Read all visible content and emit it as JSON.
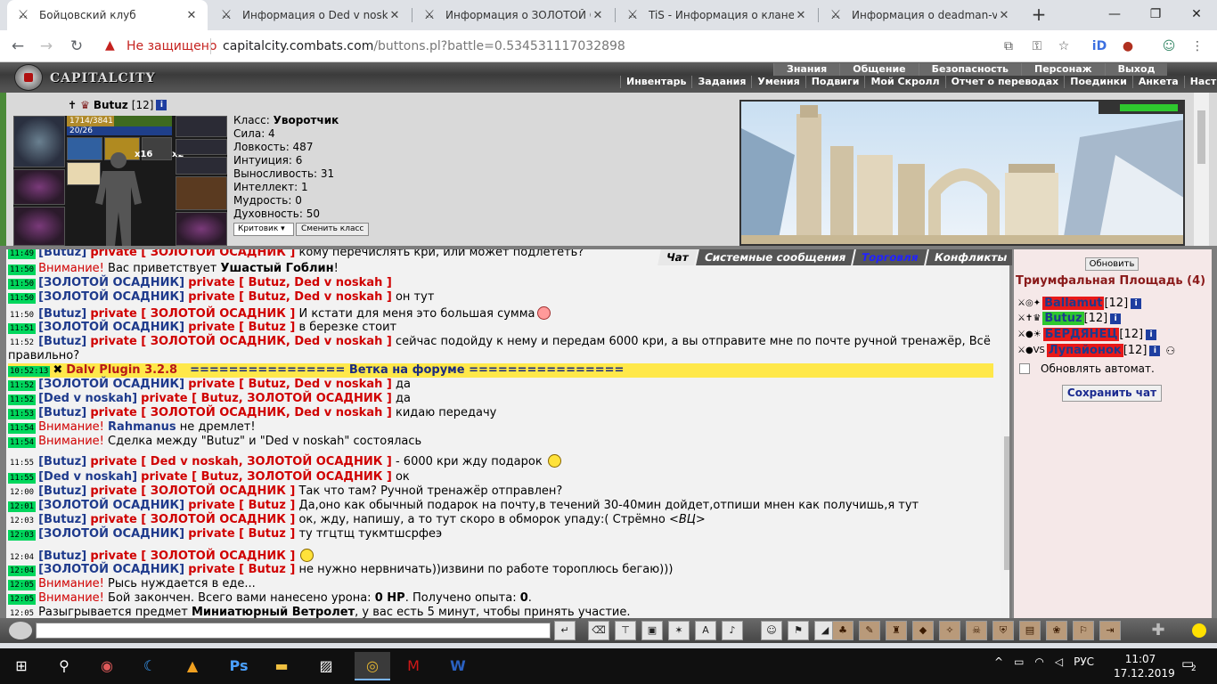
{
  "browser": {
    "tabs": [
      {
        "title": "Бойцовский клуб",
        "active": true
      },
      {
        "title": "Информация о Ded v noskah",
        "active": false
      },
      {
        "title": "Информация о ЗОЛОТОЙ ОС",
        "active": false
      },
      {
        "title": "TiS - Информация о клане",
        "active": false
      },
      {
        "title": "Информация о deadman-vip",
        "active": false
      }
    ],
    "new_tab": "+",
    "close_glyph": "✕",
    "window_controls": {
      "minimize": "—",
      "maximize": "❐",
      "close": "✕"
    },
    "security_label": "Не защищено",
    "url_host": "capitalcity.combats.com",
    "url_path": "/buttons.pl?battle=0.534531117032898"
  },
  "game": {
    "logo_text": "CAPITALCITY",
    "menu_top": [
      "Знания",
      "Общение",
      "Безопасность",
      "Персонаж",
      "Выход"
    ],
    "menu_sub": [
      "Инвентарь",
      "Задания",
      "Умения",
      "Подвиги",
      "Мой Скролл",
      "Отчет о переводах",
      "Поединки",
      "Анкета",
      "Настройки"
    ]
  },
  "character": {
    "name": "Butuz",
    "level": "[12]",
    "info_glyph": "i",
    "hp": "1714/3841",
    "hp_fraction": 0.446,
    "mana": "20/26",
    "buff_x16": "x16",
    "buff_x2": "x2",
    "class_label": "Класс:",
    "class_value": "Уворотчик",
    "stats": [
      "Сила: 4",
      "Ловкость: 487",
      "Интуиция: 6",
      "Выносливость: 31",
      "Интеллект: 1",
      "Мудрость: 0",
      "Духовность: 50"
    ],
    "class_select": "Критовик",
    "change_class_btn": "Сменить класс",
    "location_energy_fraction": 0.9
  },
  "chat_tabs": [
    "Чат",
    "Системные сообщения",
    "Торговля",
    "Конфликты"
  ],
  "chat": {
    "m0": {
      "ts": "11:49",
      "from": "[Butuz]",
      "pv": "private [ ЗОЛОТОЙ ОСАДНИК ]",
      "text": "кому перечислять кри, или может подлететь?"
    },
    "m1": {
      "ts": "11:50",
      "warn": "Внимание!",
      "text": "Вас приветствует",
      "name": "Ушастый Гоблин",
      "end": "!"
    },
    "m2": {
      "ts": "11:50",
      "from": "[ЗОЛОТОЙ ОСАДНИК]",
      "pv": "private [ Butuz, Ded v noskah ]",
      "text": ""
    },
    "m3": {
      "ts": "11:50",
      "from": "[ЗОЛОТОЙ ОСАДНИК]",
      "pv": "private [ Butuz, Ded v noskah ]",
      "text": "он тут"
    },
    "m4": {
      "ts": "11:50",
      "from": "[Butuz]",
      "pv": "private [ ЗОЛОТОЙ ОСАДНИК ]",
      "text": "И кстати для меня это большая сумма"
    },
    "m5": {
      "ts": "11:51",
      "from": "[ЗОЛОТОЙ ОСАДНИК]",
      "pv": "private [ Butuz ]",
      "text": "в березке стоит"
    },
    "m6": {
      "ts": "11:52",
      "from": "[Butuz]",
      "pv": "private [ ЗОЛОТОЙ ОСАДНИК, Ded v noskah ]",
      "text": "сейчас подойду к нему и передам 6000 кри, а вы отправите мне по почте ручной тренажёр, Всё правильно?"
    },
    "m7": {
      "ts": "10:52:13",
      "x": "✖",
      "plugin": "Dalv Plugin 3.2.8",
      "forum": "================ Ветка на форуме ================"
    },
    "m8": {
      "ts": "11:52",
      "from": "[ЗОЛОТОЙ ОСАДНИК]",
      "pv": "private [ Butuz, Ded v noskah ]",
      "text": "да"
    },
    "m9": {
      "ts": "11:52",
      "from": "[Ded v noskah]",
      "pv": "private [ Butuz, ЗОЛОТОЙ ОСАДНИК ]",
      "text": "да"
    },
    "m10": {
      "ts": "11:53",
      "from": "[Butuz]",
      "pv": "private [ ЗОЛОТОЙ ОСАДНИК, Ded v noskah ]",
      "text": "кидаю передачу"
    },
    "m11": {
      "ts": "11:54",
      "warn": "Внимание!",
      "name": "Rahmanus",
      "text": "не дремлет!"
    },
    "m12": {
      "ts": "11:54",
      "warn": "Внимание!",
      "text": "Сделка между \"Butuz\" и \"Ded v noskah\" состоялась"
    },
    "m13": {
      "ts": "11:55",
      "from": "[Butuz]",
      "pv": "private [ Ded v noskah, ЗОЛОТОЙ ОСАДНИК ]",
      "text": "- 6000 кри жду подарок"
    },
    "m14": {
      "ts": "11:55",
      "from": "[Ded v noskah]",
      "pv": "private [ Butuz, ЗОЛОТОЙ ОСАДНИК ]",
      "text": "ок"
    },
    "m15": {
      "ts": "12:00",
      "from": "[Butuz]",
      "pv": "private [ ЗОЛОТОЙ ОСАДНИК ]",
      "text": "Так что там? Ручной тренажёр отправлен?"
    },
    "m16": {
      "ts": "12:01",
      "from": "[ЗОЛОТОЙ ОСАДНИК]",
      "pv": "private [ Butuz ]",
      "text": "Да,оно как обычный подарок на почту,в течений 30-40мин дойдет,отпиши мнен как получишь,я тут"
    },
    "m17": {
      "ts": "12:03",
      "from": "[Butuz]",
      "pv": "private [ ЗОЛОТОЙ ОСАДНИК ]",
      "text": "ок, жду, напишу, а то тут скоро в обморок упаду:( Стрёмно",
      "tail": "<ВЦ>"
    },
    "m18": {
      "ts": "12:03",
      "from": "[ЗОЛОТОЙ ОСАДНИК]",
      "pv": "private [ Butuz ]",
      "text": "ту тгцтщ тукмтшсрфеэ"
    },
    "m19": {
      "ts": "12:04",
      "from": "[Butuz]",
      "pv": "private [ ЗОЛОТОЙ ОСАДНИК ]",
      "text": ""
    },
    "m20": {
      "ts": "12:04",
      "from": "[ЗОЛОТОЙ ОСАДНИК]",
      "pv": "private [ Butuz ]",
      "text": "не нужно нервничать))извини по работе тороплюсь бегаю)))"
    },
    "m21": {
      "ts": "12:05",
      "warn": "Внимание!",
      "text": "Рысь нуждается в еде..."
    },
    "m22": {
      "ts": "12:05",
      "warn": "Внимание!",
      "text": "Бой закончен. Всего вами нанесено урона:",
      "b1": "0 HP",
      "mid": ". Получено опыта:",
      "b2": "0",
      "end": "."
    },
    "m23": {
      "ts": "12:05",
      "text": "Разыгрывается предмет",
      "item": "Миниатюрный Ветролет",
      "end": ", у вас есть 5 минут, чтобы принять участие."
    }
  },
  "room": {
    "refresh_btn": "Обновить",
    "title": "Триумфальная Площадь (4)",
    "players": [
      {
        "name": "Ballamut",
        "level": "[12]",
        "bg": "#e81818"
      },
      {
        "name": "Butuz",
        "level": "[12]",
        "bg": "#2ec82e"
      },
      {
        "name": "БЕРДЯНЕЦ",
        "level": "[12]",
        "bg": "#e81818"
      },
      {
        "name": "Лупайонок",
        "level": "[12]",
        "bg": "#e81818"
      }
    ],
    "auto_refresh": "Обновлять автомат.",
    "save_chat": "Сохранить чат"
  },
  "taskbar": {
    "lang": "РУС",
    "time": "11:07",
    "date": "17.12.2019",
    "notifications": "2"
  }
}
